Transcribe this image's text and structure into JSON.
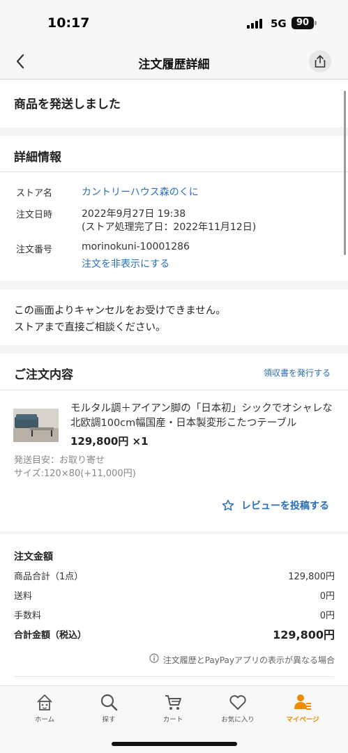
{
  "status_bar": {
    "time": "10:17",
    "network": "5G",
    "battery": "90"
  },
  "nav": {
    "title": "注文履歴詳細"
  },
  "shipping_status": "商品を発送しました",
  "details": {
    "heading": "詳細情報",
    "store_label": "ストア名",
    "store_name": "カントリーハウス森のくに",
    "date_label": "注文日時",
    "date_value": "2022年9月27日 19:38",
    "date_sub": "(ストア処理完了日：2022年11月12日)",
    "order_label": "注文番号",
    "order_number": "morinokuni-10001286",
    "hide_link": "注文を非表示にする"
  },
  "cancel_notice": {
    "line1": "この画面よりキャンセルをお受けできません。",
    "line2": "ストアまで直接ご相談ください。"
  },
  "order_contents": {
    "heading": "ご注文内容",
    "receipt_link": "領収書を発行する",
    "product": {
      "title": "モルタル調＋アイアン脚の「日本初」シックでオシャレな北欧調100cm幅国産・日本製変形こたつテーブル",
      "price": "129,800円 ×1",
      "shipping_estimate": "発送目安：お取り寄せ",
      "size": "サイズ:120×80(+11,000円)"
    },
    "review_button": "レビューを投稿する"
  },
  "amounts": {
    "heading": "注文金額",
    "rows": [
      {
        "label": "商品合計（1点）",
        "value": "129,800円"
      },
      {
        "label": "送料",
        "value": "0円"
      },
      {
        "label": "手数料",
        "value": "0円"
      }
    ],
    "total_label": "合計金額（税込）",
    "total_value": "129,800円",
    "note": "注文履歴とPayPayアプリの表示が異なる場合"
  },
  "tabbar": {
    "items": [
      {
        "label": "ホーム",
        "icon": "home-icon"
      },
      {
        "label": "探す",
        "icon": "search-icon"
      },
      {
        "label": "カート",
        "icon": "cart-icon"
      },
      {
        "label": "お気に入り",
        "icon": "heart-icon"
      },
      {
        "label": "マイページ",
        "icon": "person-icon"
      }
    ],
    "active_color": "#f08a00"
  },
  "colors": {
    "link": "#2a6ebb",
    "accent": "#f08a00"
  }
}
